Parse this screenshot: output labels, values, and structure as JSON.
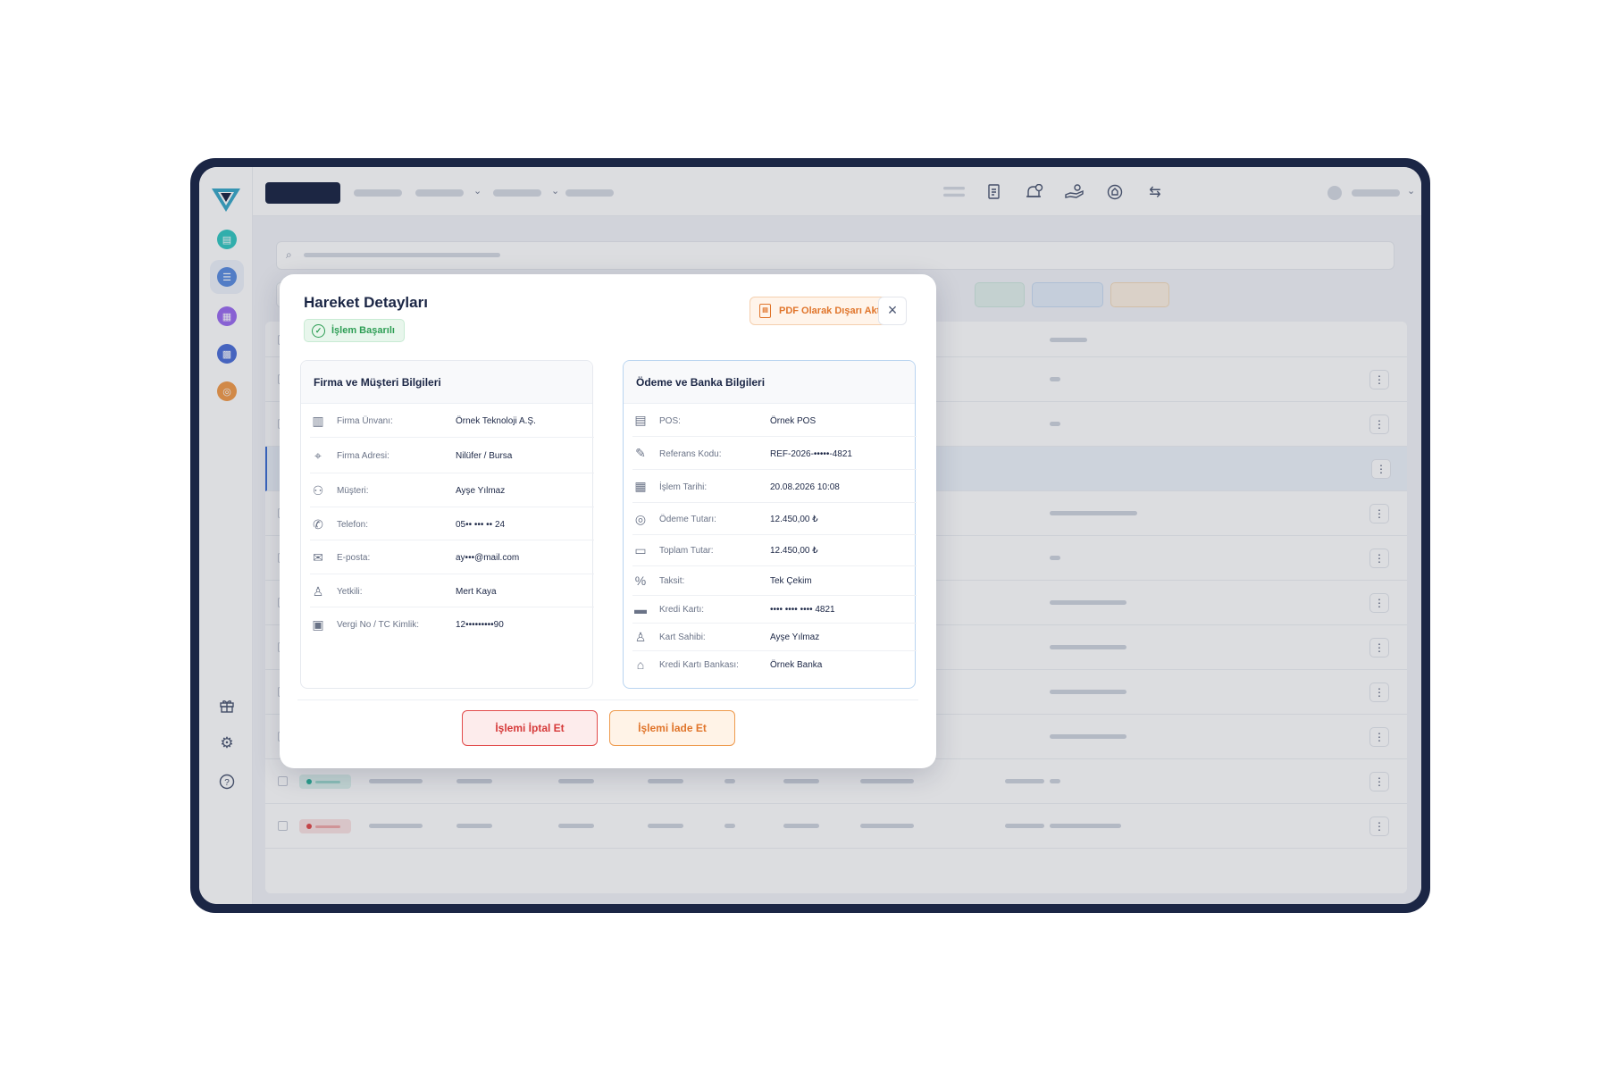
{
  "modal": {
    "title": "Hareket Detayları",
    "status": "İşlem Başarılı",
    "pdf_button": "PDF Olarak Dışarı Aktar",
    "close_label": "×",
    "cancel_button": "İşlemi İptal Et",
    "refund_button": "İşlemi İade Et"
  },
  "company_panel": {
    "title": "Firma ve Müşteri Bilgileri",
    "fields": [
      {
        "label": "Firma Ünvanı:",
        "value": "Örnek Teknoloji A.Ş.",
        "icon": "building-icon"
      },
      {
        "label": "Firma Adresi:",
        "value": "Nilüfer / Bursa",
        "icon": "location-pin-icon"
      },
      {
        "label": "Müşteri:",
        "value": "Ayşe Yılmaz",
        "icon": "users-icon"
      },
      {
        "label": "Telefon:",
        "value": "05•• ••• •• 24",
        "icon": "phone-icon"
      },
      {
        "label": "E-posta:",
        "value": "ay•••@mail.com",
        "icon": "mail-icon"
      },
      {
        "label": "Yetkili:",
        "value": "Mert Kaya",
        "icon": "user-icon"
      },
      {
        "label": "Vergi No / TC Kimlik:",
        "value": "12•••••••••90",
        "icon": "id-card-icon"
      }
    ]
  },
  "payment_panel": {
    "title": "Ödeme ve Banka Bilgileri",
    "fields": [
      {
        "label": "POS:",
        "value": "Örnek POS",
        "icon": "pos-terminal-icon"
      },
      {
        "label": "Referans Kodu:",
        "value": "REF-2026-•••••-4821",
        "icon": "edit-icon"
      },
      {
        "label": "İşlem Tarihi:",
        "value": "20.08.2026 10:08",
        "icon": "calendar-icon"
      },
      {
        "label": "Ödeme Tutarı:",
        "value": "12.450,00 ₺",
        "icon": "coins-icon"
      },
      {
        "label": "Toplam Tutar:",
        "value": "12.450,00 ₺",
        "icon": "cash-icon"
      },
      {
        "label": "Taksit:",
        "value": "Tek Çekim",
        "icon": "percent-icon"
      },
      {
        "label": "Kredi Kartı:",
        "value": "•••• •••• •••• 4821",
        "icon": "credit-card-icon"
      },
      {
        "label": "Kart Sahibi:",
        "value": "Ayşe Yılmaz",
        "icon": "user-icon"
      },
      {
        "label": "Kredi Kartı Bankası:",
        "value": "Örnek Banka",
        "icon": "bank-icon"
      }
    ]
  },
  "colors": {
    "brand": "#1b2645",
    "accent": "#3aa9c9",
    "success": "#2e9e55",
    "danger": "#d63a3a",
    "warning": "#e0752b"
  },
  "icons": {
    "logo": "brand-v-logo-icon",
    "sidebar": [
      "chat-icon",
      "list-icon",
      "document-icon",
      "grid-icon",
      "target-icon"
    ],
    "sidebar_bottom": [
      "gift-icon",
      "gear-icon",
      "help-icon"
    ],
    "topbar": [
      "menu-lines-icon",
      "receipt-icon",
      "bell-clock-icon",
      "hand-coin-icon",
      "shield-icon",
      "transfer-icon"
    ]
  }
}
